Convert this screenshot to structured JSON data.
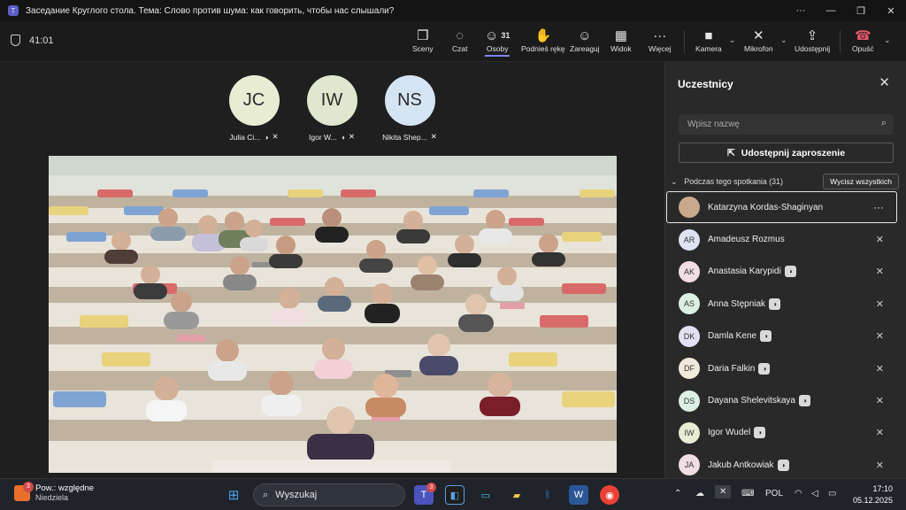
{
  "window": {
    "title": "Заседание Круглого стола. Тема: Слово против шума: как говорить, чтобы нас слышали?",
    "more": "···",
    "minimize": "—",
    "maximize": "❐",
    "close": "✕"
  },
  "toolbar": {
    "timer": "41:01",
    "buttons": {
      "sceny": "Sceny",
      "czat": "Czat",
      "osoby": "Osoby",
      "osoby_count": "31",
      "podnies": "Podnieś rękę",
      "zareaguj": "Zareaguj",
      "widok": "Widok",
      "wiecej": "Więcej",
      "kamera": "Kamera",
      "mikrofon": "Mikrofon",
      "udostepnij": "Udostępnij",
      "opusc": "Opuść"
    }
  },
  "tiles": [
    {
      "initials": "JC",
      "name": "Julia Ci...",
      "color": "#e8ecd3"
    },
    {
      "initials": "IW",
      "name": "Igor W...",
      "color": "#dfe8cf"
    },
    {
      "initials": "NS",
      "name": "Nikita Shep...",
      "color": "#d5e4f3"
    }
  ],
  "panel": {
    "title": "Uczestnicy",
    "search_placeholder": "Wpisz nazwę",
    "share_invite": "Udostępnij zaproszenie",
    "section": "Podczas tego spotkania (31)",
    "mute_all": "Wycisz wszystkich",
    "participants": [
      {
        "name": "Katarzyna Kordas-Shaginyan",
        "initials": "",
        "color": "#c9a98c",
        "selected": true,
        "badge": false
      },
      {
        "name": "Amadeusz Rozmus",
        "initials": "AR",
        "color": "#dde3f2",
        "badge": false
      },
      {
        "name": "Anastasia Karypidi",
        "initials": "AK",
        "color": "#f2dde3",
        "badge": true
      },
      {
        "name": "Anna Stępniak",
        "initials": "AS",
        "color": "#dcefe3",
        "badge": true
      },
      {
        "name": "Damla Kene",
        "initials": "DK",
        "color": "#e3e0f3",
        "badge": true
      },
      {
        "name": "Daria Falkin",
        "initials": "DF",
        "color": "#f3e8dc",
        "badge": true
      },
      {
        "name": "Dayana Shelevitskaya",
        "initials": "DS",
        "color": "#dcefe3",
        "badge": true
      },
      {
        "name": "Igor Wudel",
        "initials": "IW",
        "color": "#e8ecd3",
        "badge": true
      },
      {
        "name": "Jakub Antkowiak",
        "initials": "JA",
        "color": "#f2dde3",
        "badge": true
      }
    ]
  },
  "taskbar": {
    "weather_badge": "3",
    "weather_line1": "Pow.: względne",
    "weather_line2": "Niedziela",
    "search": "Wyszukaj",
    "teams_badge": "3",
    "lang": "POL",
    "time": "17:10",
    "date": "05.12.2025"
  },
  "colors": {
    "accent": "#7f85f5",
    "leave": "#c4314b"
  }
}
